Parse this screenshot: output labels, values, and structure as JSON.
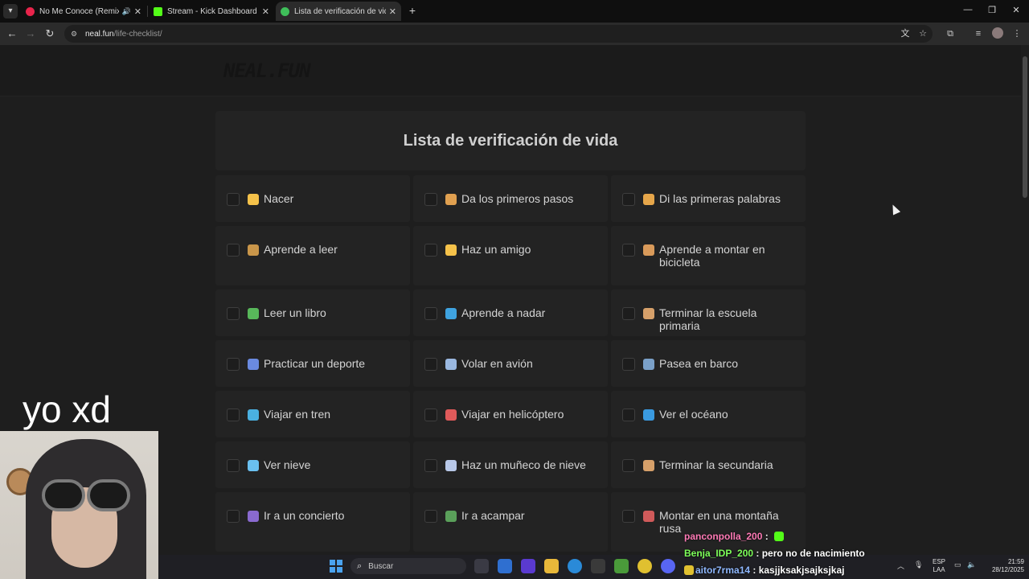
{
  "browser": {
    "tabs": [
      {
        "title": "No Me Conoce (Remix) - Yo",
        "favicon_color": "#e8244b",
        "audio": true,
        "active": false
      },
      {
        "title": "Stream - Kick Dashboard",
        "favicon_color": "#53fc18",
        "audio": false,
        "active": false
      },
      {
        "title": "Lista de verificación de vida",
        "favicon_color": "#3fbf5a",
        "audio": false,
        "active": true
      }
    ],
    "url_host": "neal.fun",
    "url_path": "/life-checklist/"
  },
  "site": {
    "logo": "NEAL.FUN",
    "title": "Lista de verificación de vida"
  },
  "checklist": [
    {
      "label": "Nacer",
      "icon": "baby-emoji",
      "color": "#f5c24a"
    },
    {
      "label": "Da los primeros pasos",
      "icon": "walking-person-emoji",
      "color": "#e0a050"
    },
    {
      "label": "Di las primeras palabras",
      "icon": "speaking-emoji",
      "color": "#e6a64a"
    },
    {
      "label": "Aprende a leer",
      "icon": "student-emoji",
      "color": "#c9964a"
    },
    {
      "label": "Haz un amigo",
      "icon": "hugging-face-emoji",
      "color": "#f5c24a"
    },
    {
      "label": "Aprende a montar en bicicleta",
      "icon": "cyclist-emoji",
      "color": "#d99a5a"
    },
    {
      "label": "Leer un libro",
      "icon": "green-book-emoji",
      "color": "#58b85a"
    },
    {
      "label": "Aprende a nadar",
      "icon": "swimmer-emoji",
      "color": "#3fa3e0"
    },
    {
      "label": "Terminar la escuela primaria",
      "icon": "school-emoji",
      "color": "#d6a06a"
    },
    {
      "label": "Practicar un deporte",
      "icon": "ball-emoji",
      "color": "#6a8ae0"
    },
    {
      "label": "Volar en avión",
      "icon": "airplane-emoji",
      "color": "#9ab8e0"
    },
    {
      "label": "Pasea en barco",
      "icon": "ship-emoji",
      "color": "#7aa0c8"
    },
    {
      "label": "Viajar en tren",
      "icon": "train-emoji",
      "color": "#4ab0e0"
    },
    {
      "label": "Viajar en helicóptero",
      "icon": "helicopter-emoji",
      "color": "#e05a5a"
    },
    {
      "label": "Ver el océano",
      "icon": "wave-emoji",
      "color": "#3a9ae0"
    },
    {
      "label": "Ver nieve",
      "icon": "snowflake-emoji",
      "color": "#6ac0f0"
    },
    {
      "label": "Haz un muñeco de nieve",
      "icon": "snowman-emoji",
      "color": "#b8c8e8"
    },
    {
      "label": "Terminar la secundaria",
      "icon": "school-emoji",
      "color": "#d6a06a"
    },
    {
      "label": "Ir a un concierto",
      "icon": "music-notes-emoji",
      "color": "#8a6ad0"
    },
    {
      "label": "Ir a acampar",
      "icon": "camping-emoji",
      "color": "#5aa05a"
    },
    {
      "label": "Montar en una montaña rusa",
      "icon": "roller-coaster-emoji",
      "color": "#d05a5a"
    }
  ],
  "overlay": {
    "caption": "yo xd"
  },
  "chat": [
    {
      "user": "panconpolla_200",
      "text": " : ",
      "user_color": "#ff7ab6",
      "badge": true
    },
    {
      "user": "Benja_IDP_200",
      "text": " : pero no de nacimiento",
      "user_color": "#7dff5a",
      "badge": false
    },
    {
      "user": "aitor7rma14",
      "text": " : kasjjksakjsajksjkaj",
      "user_color": "#8fb8ff",
      "badge": false
    }
  ],
  "taskbar": {
    "search_placeholder": "Buscar",
    "lang_top": "ESP",
    "lang_bottom": "LAA",
    "time": "21:59",
    "date": "28/12/2025"
  }
}
